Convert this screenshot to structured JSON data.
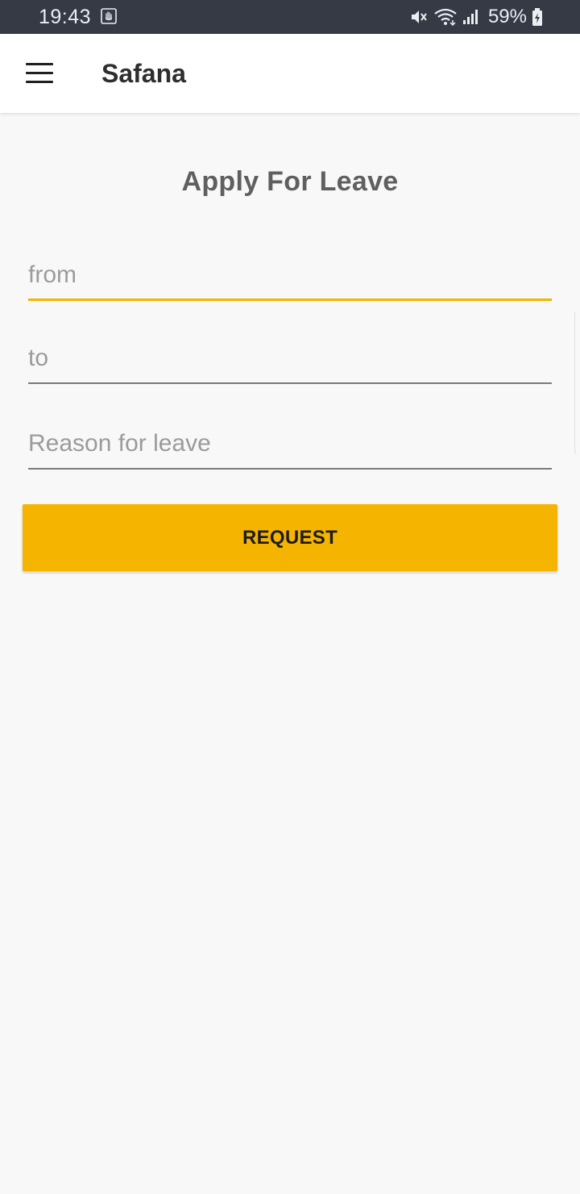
{
  "status_bar": {
    "time": "19:43",
    "battery_percent": "59%",
    "icons": [
      "hand-notification-icon",
      "mute-icon",
      "wifi-icon",
      "signal-icon",
      "battery-charging-icon"
    ]
  },
  "app_bar": {
    "title": "Safana",
    "menu_icon": "hamburger-menu-icon"
  },
  "page": {
    "title": "Apply For Leave"
  },
  "form": {
    "from_placeholder": "from",
    "from_value": "",
    "to_placeholder": "to",
    "to_value": "",
    "reason_placeholder": "Reason for leave",
    "reason_value": "",
    "submit_label": "REQUEST"
  },
  "colors": {
    "accent": "#f5b400",
    "status_bar": "#363a45",
    "background": "#f8f8f8"
  }
}
